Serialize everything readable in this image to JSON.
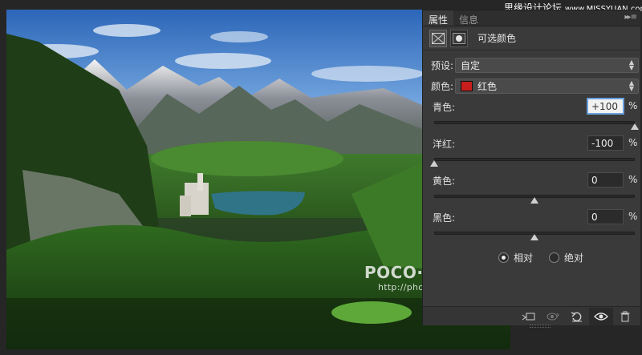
{
  "corner_brand": {
    "text": "思缘设计论坛",
    "url": "www.MISSYUAN.com"
  },
  "canvas": {
    "watermark": {
      "main": "POCO·摄影专题",
      "url": "http://photo.poco.cn/"
    }
  },
  "panel": {
    "tabs": [
      {
        "label": "属性",
        "active": true
      },
      {
        "label": "信息",
        "active": false
      }
    ],
    "menu_icon": "panel-menu-icon",
    "title": "可选颜色",
    "preset": {
      "label": "预设:",
      "value": "自定"
    },
    "colors": {
      "label": "颜色:",
      "value": "红色",
      "swatch": "#c81d1d"
    },
    "sliders": [
      {
        "label": "青色:",
        "value": "+100",
        "unit": "%",
        "level": 1.0,
        "focused": true
      },
      {
        "label": "洋红:",
        "value": "-100",
        "unit": "%",
        "level": 0.0,
        "focused": false
      },
      {
        "label": "黄色:",
        "value": "0",
        "unit": "%",
        "level": 0.5,
        "focused": false
      },
      {
        "label": "黑色:",
        "value": "0",
        "unit": "%",
        "level": 0.5,
        "focused": false
      }
    ],
    "method": {
      "relative": {
        "label": "相对",
        "checked": true
      },
      "absolute": {
        "label": "绝对",
        "checked": false
      }
    },
    "footer_icons": [
      "clip-to-layer-icon",
      "view-previous-icon",
      "reset-icon",
      "visibility-eye-icon",
      "trash-icon"
    ]
  }
}
